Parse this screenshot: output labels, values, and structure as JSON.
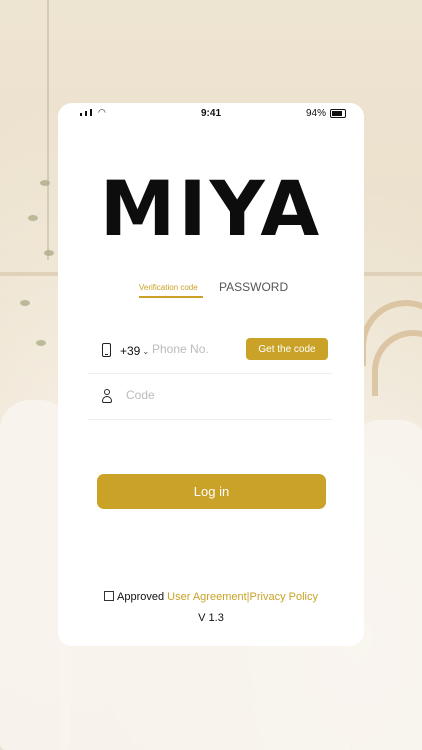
{
  "status_bar": {
    "time": "9:41",
    "battery": "94%"
  },
  "brand": {
    "logo_text": "MIYA"
  },
  "tabs": [
    {
      "label": "Verification code",
      "active": true
    },
    {
      "label": "PASSWORD",
      "active": false
    }
  ],
  "phone": {
    "country_code": "+39",
    "placeholder": "Phone No.",
    "value": "",
    "get_code_label": "Get the code"
  },
  "code": {
    "placeholder": "Code",
    "value": ""
  },
  "login_label": "Log in",
  "agreement": {
    "checked": false,
    "prefix": "Approved",
    "user_agreement": "User Agreement",
    "separator": "|",
    "privacy_policy": "Privacy Policy"
  },
  "version": "V 1.3",
  "colors": {
    "accent": "#c9a227",
    "text": "#111111",
    "placeholder": "#bbbbbb"
  }
}
